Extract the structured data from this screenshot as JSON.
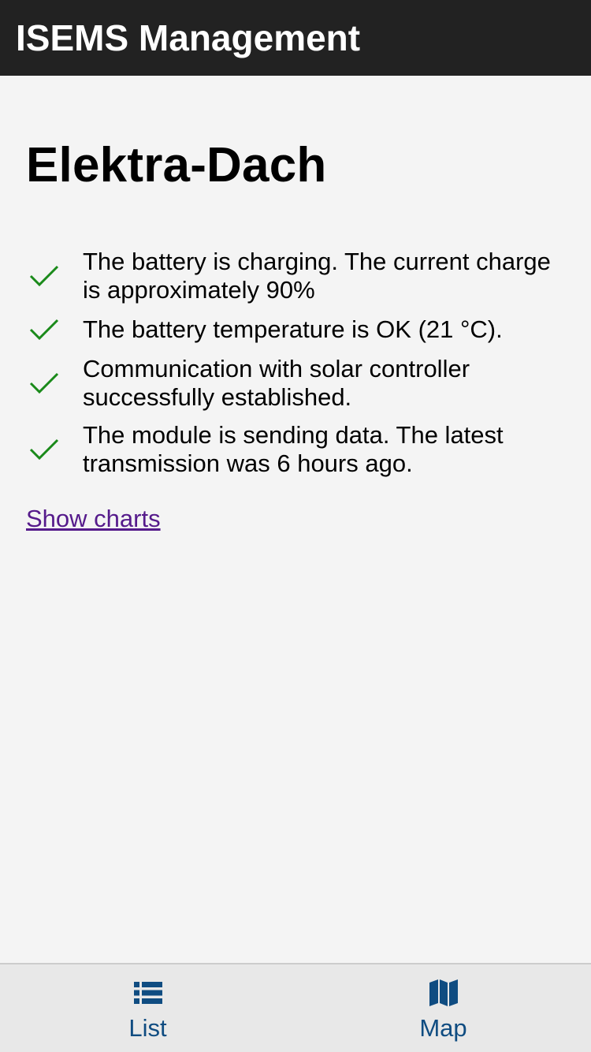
{
  "header": {
    "title": "ISEMS Management"
  },
  "site": {
    "name": "Elektra-Dach"
  },
  "status_items": [
    {
      "icon": "check-icon",
      "text": "The battery is charging. The current charge is approximately 90%"
    },
    {
      "icon": "check-icon",
      "text": "The battery temperature is OK (21 °C)."
    },
    {
      "icon": "check-icon",
      "text": "Communication with solar controller successfully established."
    },
    {
      "icon": "check-icon",
      "text": "The module is sending data. The latest transmission was 6 hours ago."
    }
  ],
  "links": {
    "show_charts": "Show charts"
  },
  "tabs": [
    {
      "icon": "list-icon",
      "label": "List"
    },
    {
      "icon": "map-icon",
      "label": "Map"
    }
  ],
  "colors": {
    "header_bg": "#222222",
    "page_bg": "#f4f4f4",
    "check": "#1a8a1a",
    "link_visited": "#551a8b",
    "tab_accent": "#0f4c81",
    "tab_bar_bg": "#e8e8e8"
  }
}
